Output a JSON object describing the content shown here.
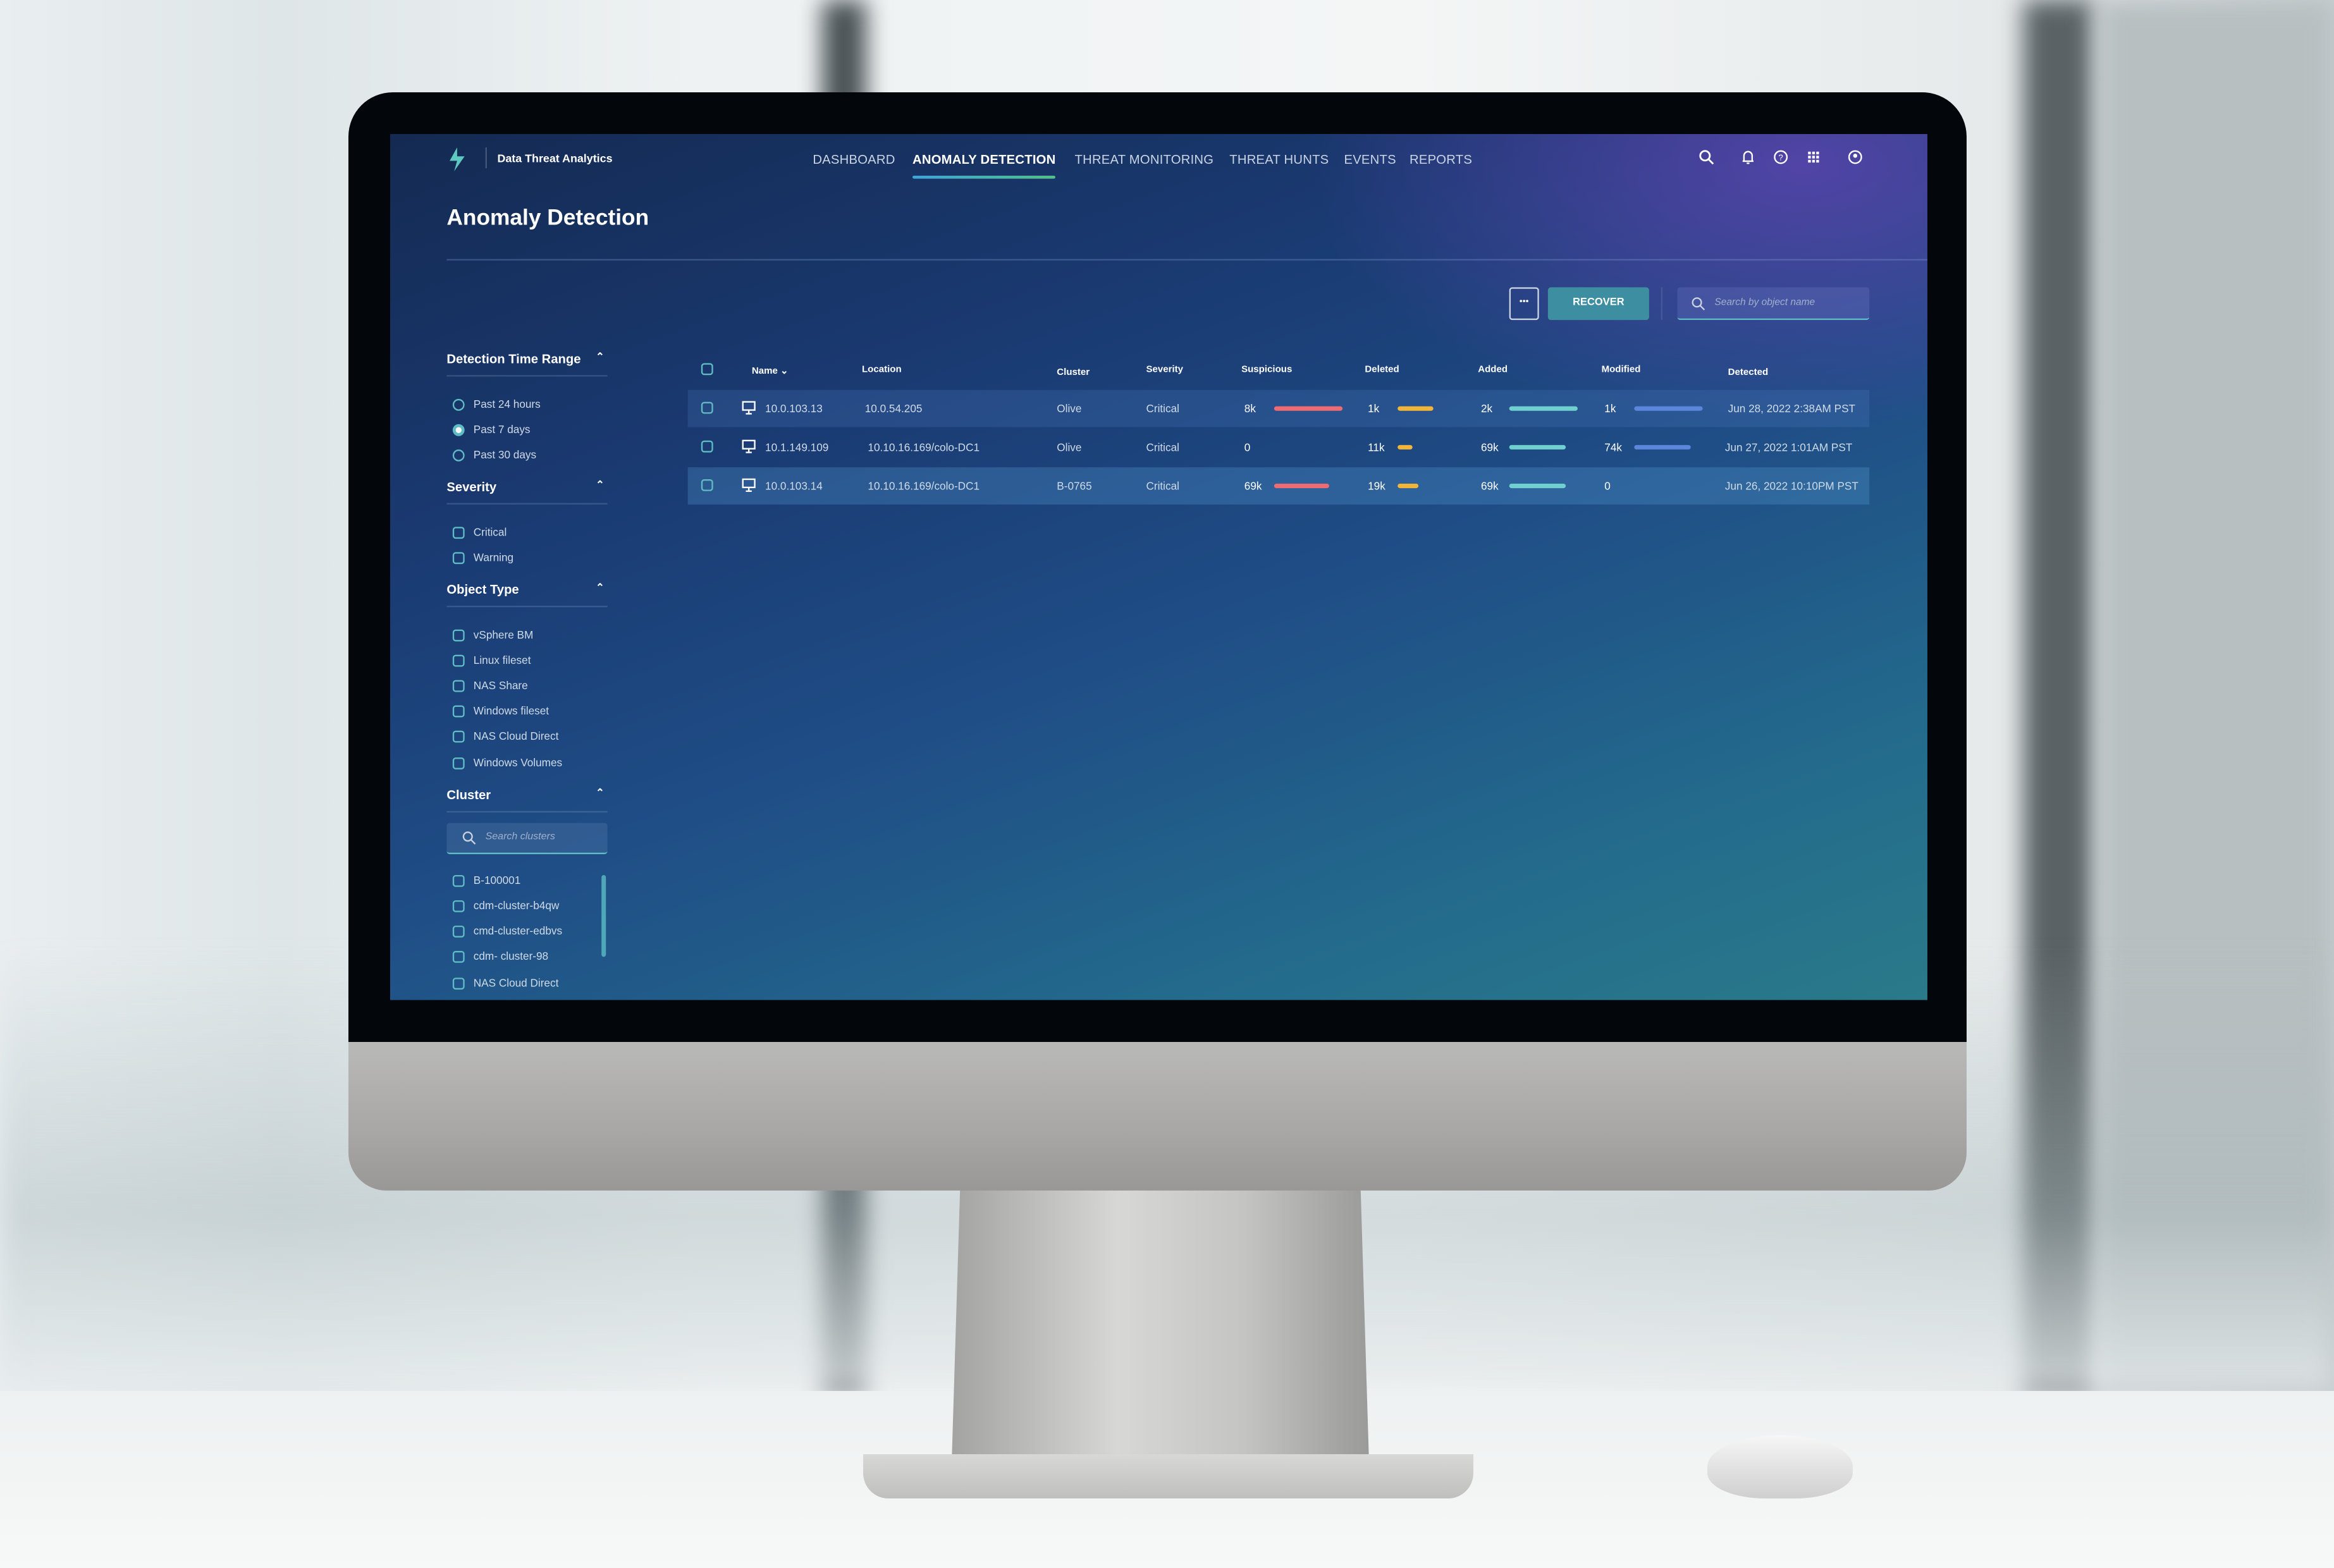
{
  "app": {
    "title": "Data Threat Analytics"
  },
  "nav": {
    "items": [
      "DASHBOARD",
      "ANOMALY DETECTION",
      "THREAT MONITORING",
      "THREAT HUNTS",
      "EVENTS",
      "REPORTS"
    ],
    "active": "ANOMALY DETECTION"
  },
  "header_icons": [
    "search-icon",
    "bell-icon",
    "help-icon",
    "apps-grid-icon",
    "user-icon"
  ],
  "page": {
    "title": "Anomaly Detection"
  },
  "toolbar": {
    "more_label": "•••",
    "recover_label": "RECOVER",
    "search_placeholder": "Search by object name"
  },
  "filters": {
    "time": {
      "title": "Detection Time Range",
      "options": [
        "Past 24 hours",
        "Past 7 days",
        "Past 30 days"
      ],
      "selected": "Past 7 days"
    },
    "severity": {
      "title": "Severity",
      "options": [
        "Critical",
        "Warning"
      ]
    },
    "object_type": {
      "title": "Object Type",
      "options": [
        "vSphere BM",
        "Linux fileset",
        "NAS Share",
        "Windows fileset",
        "NAS Cloud Direct",
        "Windows Volumes"
      ]
    },
    "cluster": {
      "title": "Cluster",
      "search_placeholder": "Search clusters",
      "options": [
        "B-100001",
        "cdm-cluster-b4qw",
        "cmd-cluster-edbvs",
        "cdm- cluster-98",
        "NAS Cloud Direct"
      ]
    }
  },
  "table": {
    "columns": [
      "Name",
      "Location",
      "Cluster",
      "Severity",
      "Suspicious",
      "Deleted",
      "Added",
      "Modified",
      "Detected"
    ],
    "sort": "Name",
    "rows": [
      {
        "name": "10.0.103.13",
        "location": "10.0.54.205",
        "cluster": "Olive",
        "severity": "Critical",
        "suspicious": "8k",
        "suspicious_bar": 1.0,
        "deleted": "1k",
        "deleted_bar": 0.52,
        "added": "2k",
        "added_bar": 1.0,
        "modified": "1k",
        "modified_bar": 1.0,
        "detected": "Jun 28, 2022 2:38AM PST"
      },
      {
        "name": "10.1.149.109",
        "location": "10.10.16.169/colo-DC1",
        "cluster": "Olive",
        "severity": "Critical",
        "suspicious": "0",
        "suspicious_bar": 0,
        "deleted": "11k",
        "deleted_bar": 0.22,
        "added": "69k",
        "added_bar": 0.83,
        "modified": "74k",
        "modified_bar": 0.83,
        "detected": "Jun 27, 2022 1:01AM PST"
      },
      {
        "name": "10.0.103.14",
        "location": "10.10.16.169/colo-DC1",
        "cluster": "B-0765",
        "severity": "Critical",
        "suspicious": "69k",
        "suspicious_bar": 0.8,
        "deleted": "19k",
        "deleted_bar": 0.3,
        "added": "69k",
        "added_bar": 0.83,
        "modified": "0",
        "modified_bar": 0,
        "detected": "Jun 26, 2022 10:10PM PST"
      }
    ]
  },
  "colors": {
    "suspicious": "#ee6b73",
    "deleted": "#f2b53a",
    "added": "#6fd0cf",
    "modified": "#5b86dc",
    "accent": "#3c8ea0"
  }
}
